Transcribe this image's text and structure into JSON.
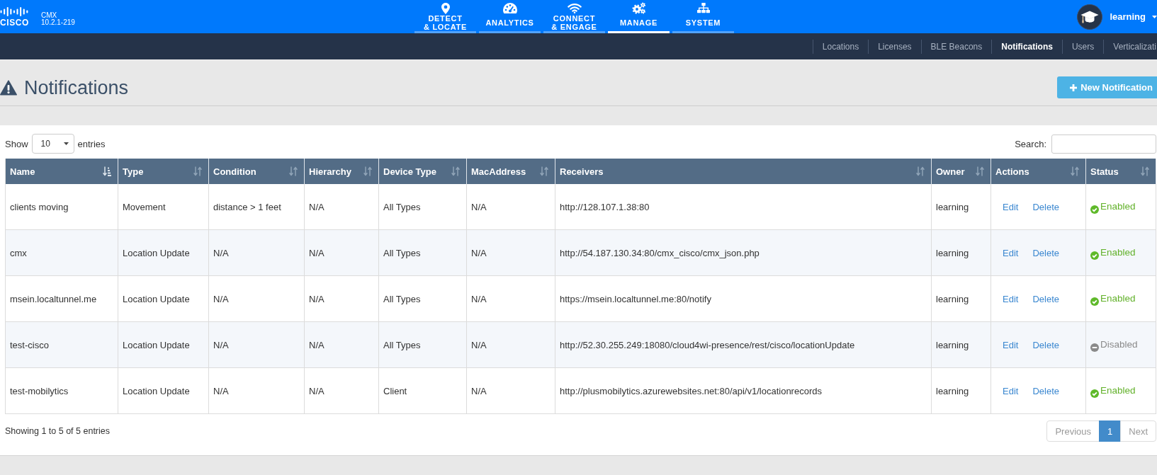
{
  "header": {
    "logo_text": "CISCO",
    "product": "CMX",
    "version": "10.2.1-219",
    "nav": [
      {
        "label": "DETECT\n& LOCATE",
        "selected": false
      },
      {
        "label": "ANALYTICS",
        "selected": false
      },
      {
        "label": "CONNECT\n& ENGAGE",
        "selected": false
      },
      {
        "label": "MANAGE",
        "selected": true
      },
      {
        "label": "SYSTEM",
        "selected": false
      }
    ],
    "user": {
      "name": "learning"
    }
  },
  "subnav": [
    {
      "label": "Locations",
      "selected": false
    },
    {
      "label": "Licenses",
      "selected": false
    },
    {
      "label": "BLE Beacons",
      "selected": false
    },
    {
      "label": "Notifications",
      "selected": true
    },
    {
      "label": "Users",
      "selected": false
    },
    {
      "label": "Verticalizati",
      "selected": false
    }
  ],
  "page": {
    "title": "Notifications",
    "new_button": "New Notification"
  },
  "table_controls": {
    "show_label": "Show",
    "page_size": "10",
    "entries_label": "entries",
    "search_label": "Search:"
  },
  "table": {
    "columns": [
      {
        "label": "Name",
        "sorted": true
      },
      {
        "label": "Type",
        "sorted": false
      },
      {
        "label": "Condition",
        "sorted": false
      },
      {
        "label": "Hierarchy",
        "sorted": false
      },
      {
        "label": "Device Type",
        "sorted": false
      },
      {
        "label": "MacAddress",
        "sorted": false
      },
      {
        "label": "Receivers",
        "sorted": false
      },
      {
        "label": "Owner",
        "sorted": false
      },
      {
        "label": "Actions",
        "sorted": false
      },
      {
        "label": "Status",
        "sorted": false
      }
    ],
    "rows": [
      {
        "name": "clients moving",
        "type": "Movement",
        "condition": "distance > 1 feet",
        "hierarchy": "N/A",
        "device_type": "All Types",
        "mac_address": "N/A",
        "receivers": "http://128.107.1.38:80",
        "owner": "learning",
        "actions": [
          "Edit",
          "Delete"
        ],
        "status": "Enabled",
        "enabled": true
      },
      {
        "name": "cmx",
        "type": "Location Update",
        "condition": "N/A",
        "hierarchy": "N/A",
        "device_type": "All Types",
        "mac_address": "N/A",
        "receivers": "http://54.187.130.34:80/cmx_cisco/cmx_json.php",
        "owner": "learning",
        "actions": [
          "Edit",
          "Delete"
        ],
        "status": "Enabled",
        "enabled": true
      },
      {
        "name": "msein.localtunnel.me",
        "type": "Location Update",
        "condition": "N/A",
        "hierarchy": "N/A",
        "device_type": "All Types",
        "mac_address": "N/A",
        "receivers": "https://msein.localtunnel.me:80/notify",
        "owner": "learning",
        "actions": [
          "Edit",
          "Delete"
        ],
        "status": "Enabled",
        "enabled": true
      },
      {
        "name": "test-cisco",
        "type": "Location Update",
        "condition": "N/A",
        "hierarchy": "N/A",
        "device_type": "All Types",
        "mac_address": "N/A",
        "receivers": "http://52.30.255.249:18080/cloud4wi-presence/rest/cisco/locationUpdate",
        "owner": "learning",
        "actions": [
          "Edit",
          "Delete"
        ],
        "status": "Disabled",
        "enabled": false
      },
      {
        "name": "test-mobilytics",
        "type": "Location Update",
        "condition": "N/A",
        "hierarchy": "N/A",
        "device_type": "Client",
        "mac_address": "N/A",
        "receivers": "http://plusmobilytics.azurewebsites.net:80/api/v1/locationrecords",
        "owner": "learning",
        "actions": [
          "Edit",
          "Delete"
        ],
        "status": "Enabled",
        "enabled": true
      }
    ]
  },
  "footer": {
    "info": "Showing 1 to 5 of 5 entries",
    "pagination": [
      {
        "label": "Previous",
        "selected": false,
        "disabled": true
      },
      {
        "label": "1",
        "selected": true,
        "disabled": false
      },
      {
        "label": "Next",
        "selected": false,
        "disabled": true
      }
    ]
  }
}
